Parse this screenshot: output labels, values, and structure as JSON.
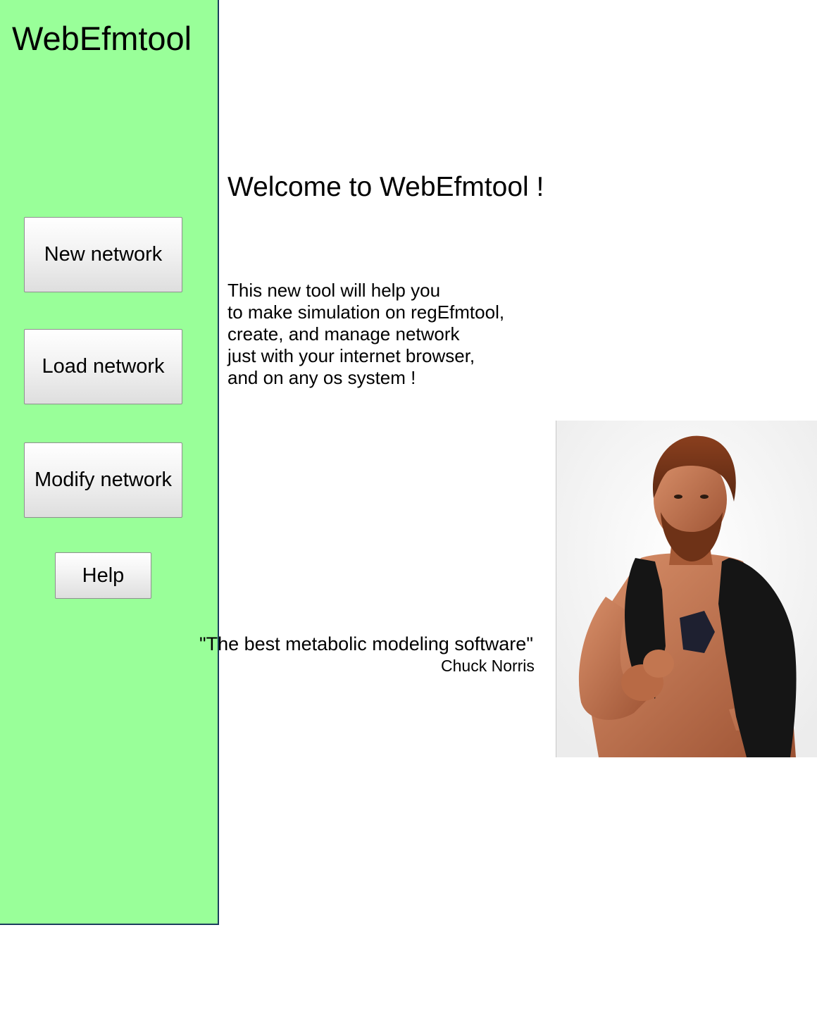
{
  "sidebar": {
    "app_title": "WebEfmtool",
    "buttons": {
      "new_network": "New network",
      "load_network": "Load network",
      "modify_network": "Modify network",
      "help": "Help"
    },
    "background_color": "#99ff99",
    "border_color": "#1a3d5c"
  },
  "main": {
    "welcome": "Welcome to WebEfmtool !",
    "intro_lines": [
      "This new tool will help you",
      "to make simulation on regEfmtool,",
      "create, and manage network",
      "just with your internet browser,",
      "and on any os system !"
    ],
    "quote": "\"The best metabolic modeling software\"",
    "quote_author": "Chuck Norris"
  }
}
